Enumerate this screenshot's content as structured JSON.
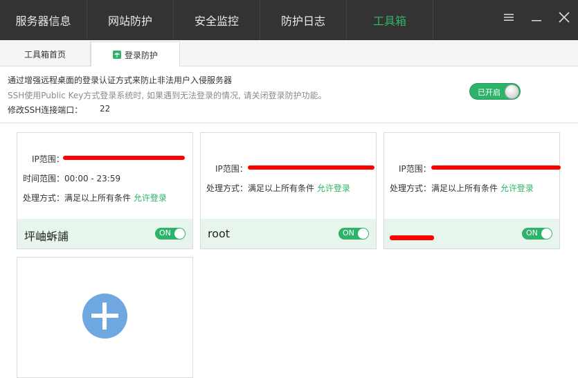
{
  "nav": {
    "tabs": [
      "服务器信息",
      "网站防护",
      "安全监控",
      "防护日志",
      "工具箱"
    ],
    "active": "工具箱",
    "minimize_icon": "☰"
  },
  "subtabs": [
    "工具箱首页",
    "登录防护"
  ],
  "description": {
    "line1": "通过增强远程桌面的登录认证方式来防止非法用户入侵服务器",
    "line2": "SSH使用Public Key方式登录系统时, 如果遇到无法登录的情况, 请关闭登录防护功能。",
    "port_label": "修改SSH连接端口：",
    "port_value": "22",
    "toggle_label": "已开启"
  },
  "rules": [
    {
      "ip_label": "IP范围：",
      "time_label": "时间范围：00:00 - 23:59",
      "method_label": "处理方式：满足以上所有条件",
      "method_value": "允许登录",
      "name": "坪岫蚸誧",
      "toggle": "ON"
    },
    {
      "ip_label": "IP范围：",
      "method_label": "处理方式：满足以上所有条件",
      "method_value": "允许登录",
      "name": "root",
      "toggle": "ON"
    },
    {
      "ip_label": "IP范围：",
      "method_label": "处理方式：满足以上所有条件",
      "method_value": "允许登录",
      "name": "",
      "toggle": "ON"
    }
  ],
  "colors": {
    "accent_green": "#2db36a",
    "topbar": "#333333",
    "add_blue": "#6fa8e0"
  }
}
